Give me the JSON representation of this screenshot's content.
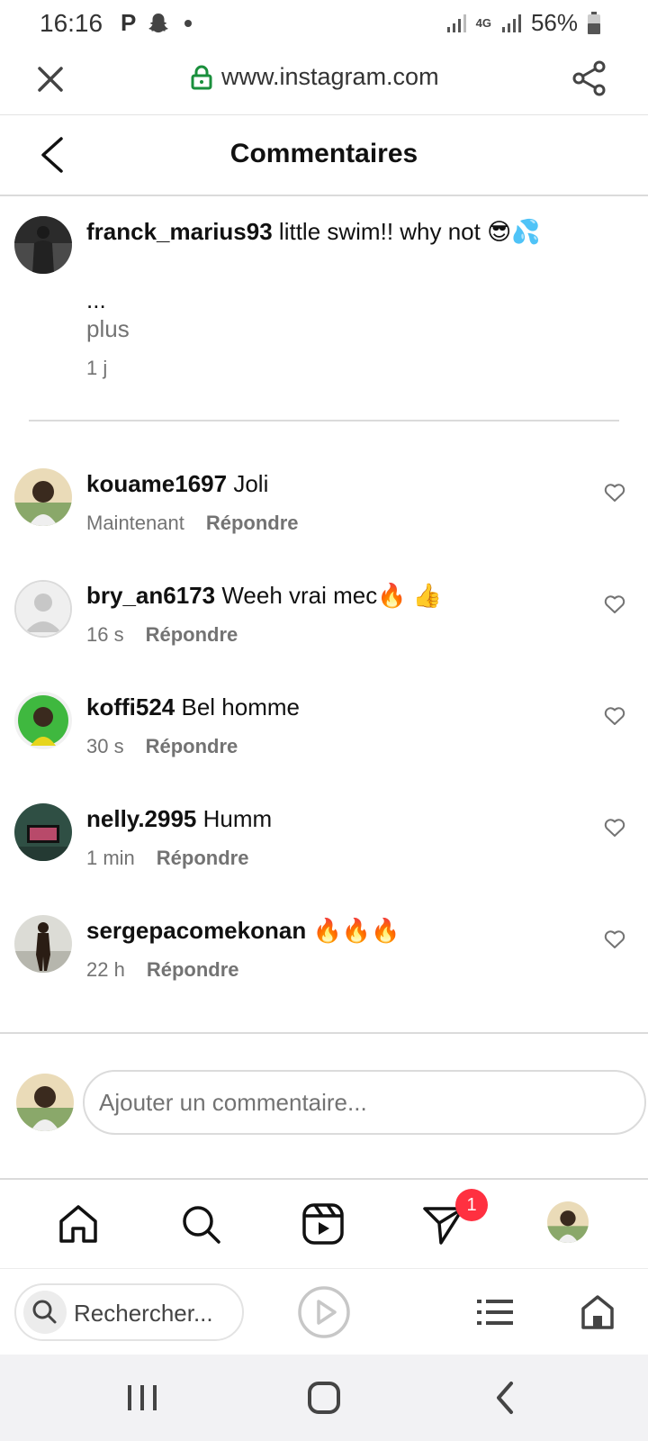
{
  "status_bar": {
    "time": "16:16",
    "p_label": "P",
    "network_label": "4G",
    "battery": "56%"
  },
  "browser": {
    "url": "www.instagram.com",
    "search_placeholder": "Rechercher..."
  },
  "header": {
    "title": "Commentaires"
  },
  "caption": {
    "username": "franck_marius93",
    "text": "little swim!! why not 😎💦",
    "ellipsis": "...",
    "more_label": "plus",
    "time": "1 j"
  },
  "comments": [
    {
      "username": "kouame1697",
      "text": "Joli",
      "time": "Maintenant",
      "reply_label": "Répondre"
    },
    {
      "username": "bry_an6173",
      "text": "Weeh vrai mec🔥 👍",
      "time": "16 s",
      "reply_label": "Répondre"
    },
    {
      "username": "koffi524",
      "text": "Bel homme",
      "time": "30 s",
      "reply_label": "Répondre"
    },
    {
      "username": "nelly.2995",
      "text": "Humm",
      "time": "1 min",
      "reply_label": "Répondre"
    },
    {
      "username": "sergepacomekonan",
      "text": "🔥🔥🔥",
      "time": "22 h",
      "reply_label": "Répondre"
    }
  ],
  "composer": {
    "placeholder": "Ajouter un commentaire..."
  },
  "nav": {
    "messages_badge": "1"
  },
  "colors": {
    "text": "#111111",
    "muted": "#737373",
    "divider": "#dbdbdb",
    "badge": "#ff3040",
    "lock": "#1a8f3c"
  }
}
